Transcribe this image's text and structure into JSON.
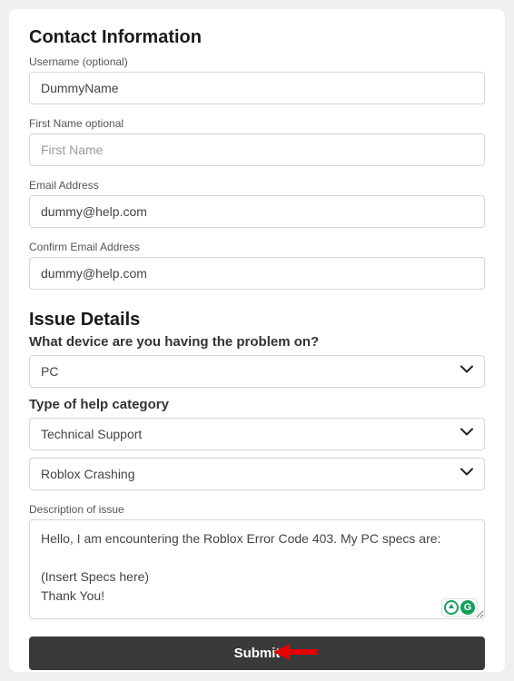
{
  "contact": {
    "heading": "Contact Information",
    "username_label": "Username (optional)",
    "username_value": "DummyName",
    "firstname_label": "First Name optional",
    "firstname_placeholder": "First Name",
    "firstname_value": "",
    "email_label": "Email Address",
    "email_value": "dummy@help.com",
    "confirm_email_label": "Confirm Email Address",
    "confirm_email_value": "dummy@help.com"
  },
  "issue": {
    "heading": "Issue Details",
    "device_label": "What device are you having the problem on?",
    "device_value": "PC",
    "category_label": "Type of help category",
    "category_value": "Technical Support",
    "subcategory_value": "Roblox Crashing",
    "description_label": "Description of issue",
    "description_value": "Hello, I am encountering the Roblox Error Code 403. My PC specs are:\n\n(Insert Specs here)\nThank You!"
  },
  "submit_label": "Submit",
  "grammarly_letter": "G"
}
